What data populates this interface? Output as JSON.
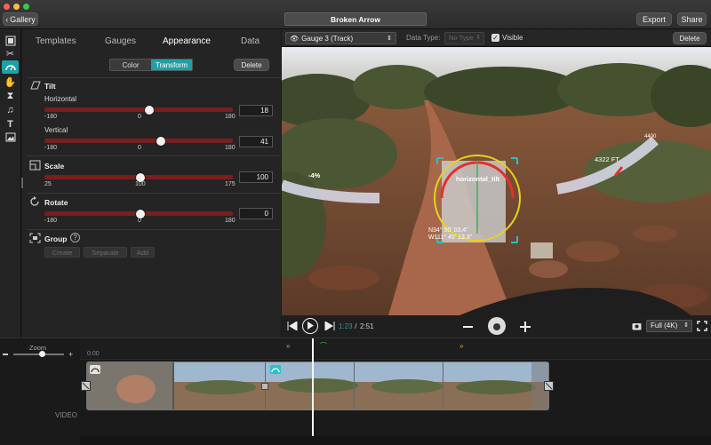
{
  "window": {
    "title": "Broken Arrow",
    "gallery_label": "Gallery",
    "export_label": "Export",
    "share_label": "Share"
  },
  "tools": [
    "film-icon",
    "scissors-icon",
    "gauge-icon",
    "hand-icon",
    "hourglass-icon",
    "music-icon",
    "text-icon",
    "image-icon"
  ],
  "panel": {
    "tabs": [
      "Templates",
      "Gauges",
      "Appearance",
      "Data"
    ],
    "subtabs": {
      "color": "Color",
      "transform": "Transform"
    },
    "delete_label": "Delete",
    "tilt": {
      "title": "Tilt",
      "horizontal": {
        "label": "Horizontal",
        "min": "-180",
        "mid": "0",
        "max": "180",
        "value": "18"
      },
      "vertical": {
        "label": "Vertical",
        "min": "-180",
        "mid": "0",
        "max": "180",
        "value": "41"
      }
    },
    "scale": {
      "title": "Scale",
      "min": "25",
      "mid": "100",
      "max": "175",
      "value": "100"
    },
    "rotate": {
      "title": "Rotate",
      "min": "-180",
      "mid": "0",
      "max": "180",
      "value": "0"
    },
    "group": {
      "title": "Group",
      "help": "?",
      "create": "Create",
      "separate": "Separate",
      "add": "Add"
    }
  },
  "viewer": {
    "gauge_select": "Gauge 3 (Track)",
    "data_type_label": "Data Type:",
    "data_type_value": "No Type",
    "visible_label": "Visible",
    "delete_label": "Delete",
    "overlay": {
      "gauge_label": "horizontal_tilt",
      "coord_line1": "N34° 50' 03.4\"",
      "coord_line2": "W111° 45' 13.3\"",
      "left_value": "-4%",
      "right_value": "4322 FT",
      "right_small": "4400"
    },
    "current_time": "1:23",
    "time_separator": " / ",
    "total_time": "2:51",
    "quality": "Full (4K)"
  },
  "timeline": {
    "zoom_label": "Zoom",
    "start_time": "0:00",
    "track_label": "VIDEO",
    "zoom_level": 0.55
  },
  "colors": {
    "accent": "#1ea0a8",
    "slider_track": "#7a1e1e"
  }
}
